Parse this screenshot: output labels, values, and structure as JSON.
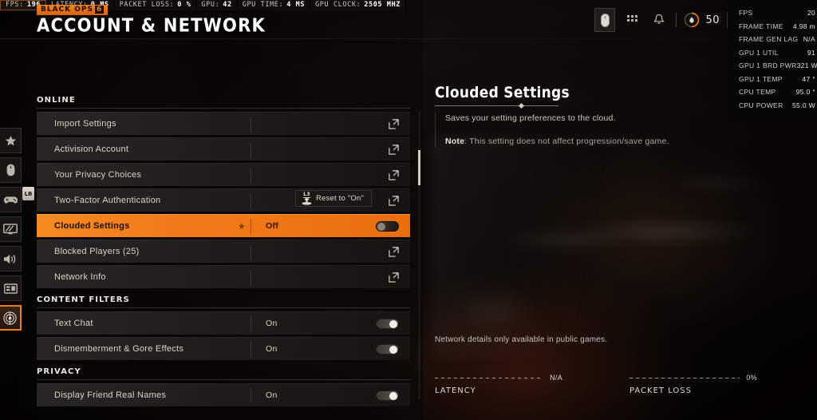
{
  "perf_hud": [
    {
      "label": "FPS:",
      "value": "196"
    },
    {
      "label": "LATENCY:",
      "value": "0 MS"
    },
    {
      "label": "PACKET LOSS:",
      "value": "0 %"
    },
    {
      "label": "GPU:",
      "value": "42"
    },
    {
      "label": "GPU TIME:",
      "value": "4 MS"
    },
    {
      "label": "GPU CLOCK:",
      "value": "2505 MHZ"
    }
  ],
  "brand": {
    "name": "BLACK OPS",
    "edition": "6"
  },
  "header": {
    "title": "ACCOUNT & NETWORK",
    "icons": [
      "mouse-icon",
      "grid-icon",
      "bell-icon"
    ],
    "currency_amount": "50"
  },
  "perf_overlay": [
    {
      "label": "FPS",
      "value": "20"
    },
    {
      "label": "FRAME TIME",
      "value": "4.98 m"
    },
    {
      "label": "FRAME GEN LAG",
      "value": "N/A"
    },
    {
      "label": "GPU 1 UTIL",
      "value": "91"
    },
    {
      "label": "GPU 1 BRD PWR",
      "value": "321 W"
    },
    {
      "label": "GPU 1 TEMP",
      "value": "47 °"
    },
    {
      "label": "CPU TEMP",
      "value": "95.0 °"
    },
    {
      "label": "CPU POWER",
      "value": "55.0 W"
    }
  ],
  "rail": {
    "items": [
      {
        "name": "star-icon",
        "label": "Favorites",
        "active": false
      },
      {
        "name": "mouse-icon",
        "label": "Mouse & Keyboard",
        "active": false
      },
      {
        "name": "controller-icon",
        "label": "Controller",
        "active": false
      },
      {
        "name": "display-icon",
        "label": "Display",
        "active": false
      },
      {
        "name": "audio-icon",
        "label": "Audio",
        "active": false
      },
      {
        "name": "interface-icon",
        "label": "Interface",
        "active": false
      },
      {
        "name": "network-icon",
        "label": "Account & Network",
        "active": true
      }
    ],
    "badge": "LB"
  },
  "settings": {
    "sections": [
      {
        "title": "ONLINE",
        "rows": [
          {
            "label": "Import Settings",
            "value": "",
            "control": "external",
            "active": false
          },
          {
            "label": "Activision Account",
            "value": "",
            "control": "external",
            "active": false
          },
          {
            "label": "Your Privacy Choices",
            "value": "",
            "control": "external",
            "active": false
          },
          {
            "label": "Two-Factor Authentication",
            "value": "",
            "control": "external",
            "active": false
          },
          {
            "label": "Clouded Settings",
            "value": "Off",
            "control": "toggle-off",
            "active": true,
            "starred": true
          },
          {
            "label": "Blocked Players (25)",
            "value": "",
            "control": "external",
            "active": false
          },
          {
            "label": "Network Info",
            "value": "",
            "control": "external",
            "active": false
          }
        ]
      },
      {
        "title": "CONTENT FILTERS",
        "rows": [
          {
            "label": "Text Chat",
            "value": "On",
            "control": "toggle-on",
            "active": false
          },
          {
            "label": "Dismemberment & Gore Effects",
            "value": "On",
            "control": "toggle-on",
            "active": false
          }
        ]
      },
      {
        "title": "PRIVACY",
        "rows": [
          {
            "label": "Display Friend Real Names",
            "value": "On",
            "control": "toggle-on",
            "active": false
          }
        ]
      }
    ],
    "reset_tooltip": {
      "button": "L3",
      "label": "Reset to \"On\""
    }
  },
  "detail": {
    "title": "Clouded Settings",
    "description": "Saves your setting preferences to the cloud.",
    "note_label": "Note",
    "note_text": ": This setting does not affect progression/save game."
  },
  "network": {
    "note": "Network details only available in public games.",
    "stats": [
      {
        "label": "LATENCY",
        "value": "N/A"
      },
      {
        "label": "PACKET LOSS",
        "value": "0%"
      }
    ]
  },
  "colors": {
    "accent": "#f07818",
    "accent_light": "#f58a22",
    "text": "#d6d2cc",
    "panel": "#2e2b28"
  }
}
